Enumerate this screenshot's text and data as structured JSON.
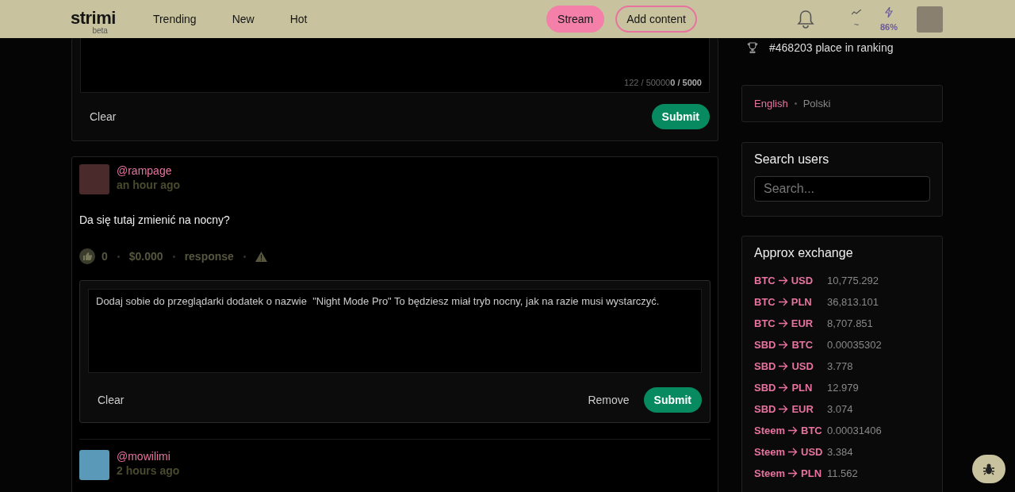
{
  "header": {
    "logo": "strimi",
    "logo_badge": "beta",
    "nav": [
      {
        "label": "Trending"
      },
      {
        "label": "New"
      },
      {
        "label": "Hot"
      }
    ],
    "stream_button": "Stream",
    "add_button": "Add content",
    "trend_reading": "~",
    "power_reading": "86%"
  },
  "editor": {
    "counter_total": "122 / 50000",
    "counter": "0 / 5000",
    "clear": "Clear",
    "submit": "Submit"
  },
  "comments": [
    {
      "user": "@rampage",
      "time": "an hour ago",
      "text": "Da się tutaj zmienić na nocny?",
      "votes": "0",
      "payout": "$0.000",
      "response": "response",
      "reply": {
        "value": "Dodaj sobie do przeglądarki dodatek o nazwie  \"Night Mode Pro\" To będziesz miał tryb nocny, jak na razie musi wystarczyć.",
        "clear": "Clear",
        "remove": "Remove",
        "submit": "Submit"
      }
    },
    {
      "user": "@mowilimi",
      "time": "2 hours ago"
    }
  ],
  "sidebar": {
    "ranking": "#468203 place in ranking",
    "languages": [
      {
        "label": "English",
        "selected": true
      },
      {
        "label": "Polski",
        "selected": false
      }
    ],
    "search_title": "Search users",
    "search_placeholder": "Search...",
    "exchange_title": "Approx exchange",
    "rates": [
      {
        "from": "BTC",
        "to": "USD",
        "value": "10,775.292"
      },
      {
        "from": "BTC",
        "to": "PLN",
        "value": "36,813.101"
      },
      {
        "from": "BTC",
        "to": "EUR",
        "value": "8,707.851"
      },
      {
        "from": "SBD",
        "to": "BTC",
        "value": "0.00035302"
      },
      {
        "from": "SBD",
        "to": "USD",
        "value": "3.778"
      },
      {
        "from": "SBD",
        "to": "PLN",
        "value": "12.979"
      },
      {
        "from": "SBD",
        "to": "EUR",
        "value": "3.074"
      },
      {
        "from": "Steem",
        "to": "BTC",
        "value": "0.00031406"
      },
      {
        "from": "Steem",
        "to": "USD",
        "value": "3.384"
      },
      {
        "from": "Steem",
        "to": "PLN",
        "value": "11.562"
      }
    ]
  }
}
